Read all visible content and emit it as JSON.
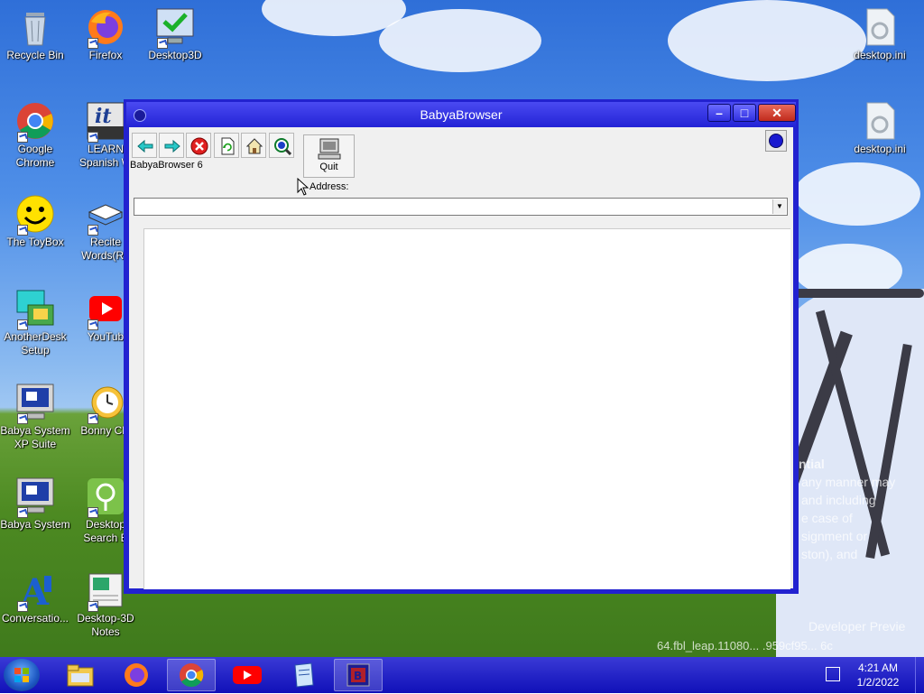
{
  "desktop": {
    "icons": [
      {
        "label": "Recycle Bin"
      },
      {
        "label": "Firefox"
      },
      {
        "label": "Desktop3D"
      },
      {
        "label": "desktop.ini"
      },
      {
        "label": "Google Chrome"
      },
      {
        "label": "LEARN Spanish W"
      },
      {
        "label": "desktop.ini"
      },
      {
        "label": "The ToyBox"
      },
      {
        "label": "Recite Words(Ru"
      },
      {
        "label": "AnotherDesk Setup"
      },
      {
        "label": "YouTub"
      },
      {
        "label": "Babya System XP Suite"
      },
      {
        "label": "Bonny Clo"
      },
      {
        "label": "Babya System"
      },
      {
        "label": "Desktop Search B"
      },
      {
        "label": "Conversatio..."
      },
      {
        "label": "Desktop-3D Notes"
      }
    ],
    "wallpaper_text": {
      "line1": "ntial",
      "line2": "any manner may",
      "line3": "and including",
      "line4": "e case of",
      "line5": "signment or",
      "line6": "ston), and",
      "build": "Developer Previe",
      "build2": "64.fbl_leap.11080... .959cf95... 6c"
    }
  },
  "window": {
    "title": "BabyaBrowser",
    "brand": "BabyaBrowser 6",
    "quit_label": "Quit",
    "address_label": "Address:",
    "address_value": "",
    "toolbar": [
      "back",
      "forward",
      "stop",
      "refresh",
      "home",
      "search"
    ]
  },
  "taskbar": {
    "items": [
      "file-explorer",
      "firefox",
      "chrome",
      "youtube",
      "notepad",
      "babyabrowser"
    ],
    "active": "chrome",
    "time": "4:21 AM",
    "date": "1/2/2022"
  },
  "colors": {
    "window_frame": "#2222d0",
    "taskbar": "#1010b8"
  }
}
